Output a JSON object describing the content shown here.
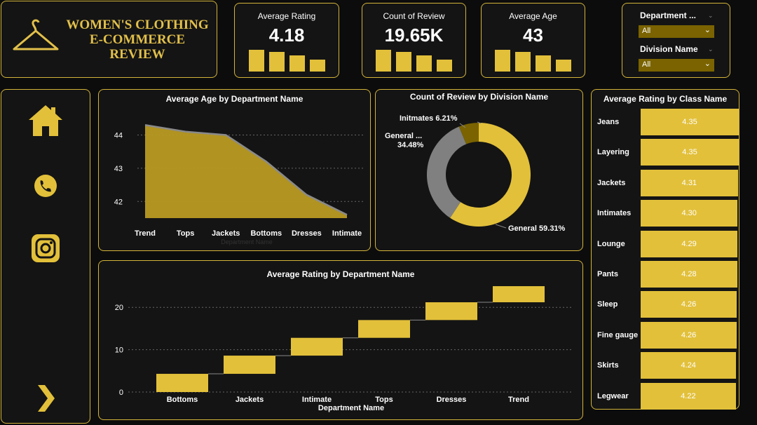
{
  "header": {
    "title_line1": "WOMEN'S CLOTHING",
    "title_line2": "E-COMMERCE",
    "title_line3": "REVIEW"
  },
  "kpis": [
    {
      "label": "Average Rating",
      "value": "4.18"
    },
    {
      "label": "Count of Review",
      "value": "19.65K"
    },
    {
      "label": "Average Age",
      "value": "43"
    }
  ],
  "filters": [
    {
      "label": "Department ...",
      "selected": "All"
    },
    {
      "label": "Division Name",
      "selected": "All"
    }
  ],
  "colors": {
    "accent": "#e2c03a",
    "dark_accent": "#7a6300",
    "grey": "#808080",
    "panel": "#141414"
  },
  "nav": {
    "icons": [
      "home-icon",
      "phone-icon",
      "instagram-icon",
      "chevron-right-icon"
    ]
  },
  "charts": {
    "age_by_dept": {
      "title": "Average Age by Department Name",
      "xlabel": "Department Name"
    },
    "review_by_division": {
      "title": "Count of Review by Division Name"
    },
    "rating_by_dept": {
      "title": "Average Rating by Department Name",
      "xlabel": "Department Name"
    },
    "rating_by_class": {
      "title": "Average Rating by Class Name"
    }
  },
  "chart_data": [
    {
      "type": "area",
      "title": "Average Age by Department Name",
      "xlabel": "Department Name",
      "ylabel": "",
      "categories": [
        "Trend",
        "Tops",
        "Jackets",
        "Bottoms",
        "Dresses",
        "Intimate"
      ],
      "values": [
        44.3,
        44.1,
        44.0,
        43.2,
        42.2,
        41.6
      ],
      "yticks": [
        42,
        43,
        44
      ],
      "ylim": [
        41.5,
        44.6
      ],
      "grid": true
    },
    {
      "type": "pie",
      "title": "Count of Review by Division Name",
      "categories": [
        "General",
        "General ...",
        "Initmates"
      ],
      "values": [
        59.31,
        34.48,
        6.21
      ],
      "labels": [
        "General 59.31%",
        "General ...",
        "34.48%",
        "Initmates 6.21%"
      ],
      "colors": [
        "#e2c03a",
        "#808080",
        "#7a6300"
      ]
    },
    {
      "type": "bar",
      "subtype": "waterfall",
      "title": "Average Rating by Department Name",
      "xlabel": "Department Name",
      "ylabel": "",
      "categories": [
        "Bottoms",
        "Jackets",
        "Intimate",
        "Tops",
        "Dresses",
        "Trend"
      ],
      "values": [
        4.3,
        4.3,
        4.2,
        4.2,
        4.2,
        3.8
      ],
      "yticks": [
        0,
        10,
        20
      ],
      "ylim": [
        0,
        26
      ],
      "grid": true
    },
    {
      "type": "bar",
      "orientation": "horizontal",
      "title": "Average Rating by Class Name",
      "categories": [
        "Jeans",
        "Layering",
        "Jackets",
        "Intimates",
        "Lounge",
        "Pants",
        "Sleep",
        "Fine gauge",
        "Skirts",
        "Legwear"
      ],
      "values": [
        4.35,
        4.35,
        4.31,
        4.3,
        4.29,
        4.28,
        4.26,
        4.26,
        4.24,
        4.22
      ],
      "value_labels": [
        "4.35",
        "4.35",
        "4.31",
        "4.30",
        "4.29",
        "4.28",
        "4.26",
        "4.26",
        "4.24",
        "4.22"
      ]
    }
  ]
}
